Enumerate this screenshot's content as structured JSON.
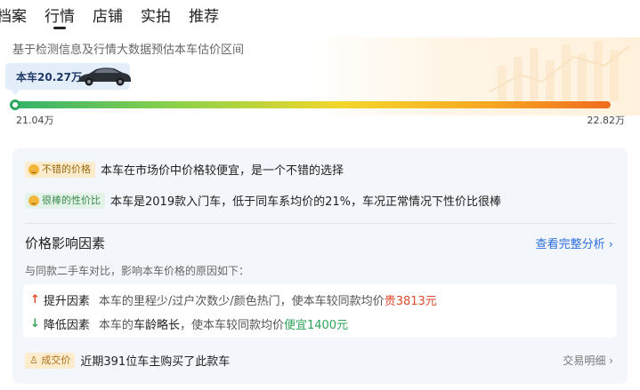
{
  "tabs": [
    {
      "label": "档案",
      "active": false
    },
    {
      "label": "行情",
      "active": true
    },
    {
      "label": "店铺",
      "active": false
    },
    {
      "label": "实拍",
      "active": false
    },
    {
      "label": "推荐",
      "active": false
    }
  ],
  "valuation": {
    "subtitle": "基于检测信息及行情大数据预估本车估价区间",
    "current_price_label": "本车20.27万",
    "range_min": "21.04万",
    "range_max": "22.82万",
    "gradient_colors": [
      "#34b36b",
      "#8ed24a",
      "#f5d62a",
      "#f7a722",
      "#f06b1e"
    ]
  },
  "evaluation": {
    "good_price": {
      "tag": "不错的价格",
      "text": "本车在市场价中价格较便宜，是一个不错的选择"
    },
    "value": {
      "tag": "很棒的性价比",
      "text": "本车是2019款入门车，低于同车系均价的21%，车况正常情况下性价比很棒"
    }
  },
  "factors": {
    "title": "价格影响因素",
    "link": "查看完整分析",
    "subtitle": "与同款二手车对比，影响本车价格的原因如下：",
    "up": {
      "label": "提升因素",
      "text": "本车的里程少/过户次数少/颜色热门，使本车较同款均价",
      "delta": "贵3813元",
      "color": "#e04a2f"
    },
    "down": {
      "label": "降低因素",
      "text_prefix": "本车的",
      "text_bold": "车龄略长",
      "text_suffix": "，使本车较同款均价",
      "delta": "便宜1400元",
      "color": "#2fa35a"
    }
  },
  "deal": {
    "tag": "成交价",
    "text": "近期391位车主购买了此款车",
    "link": "交易明细"
  }
}
